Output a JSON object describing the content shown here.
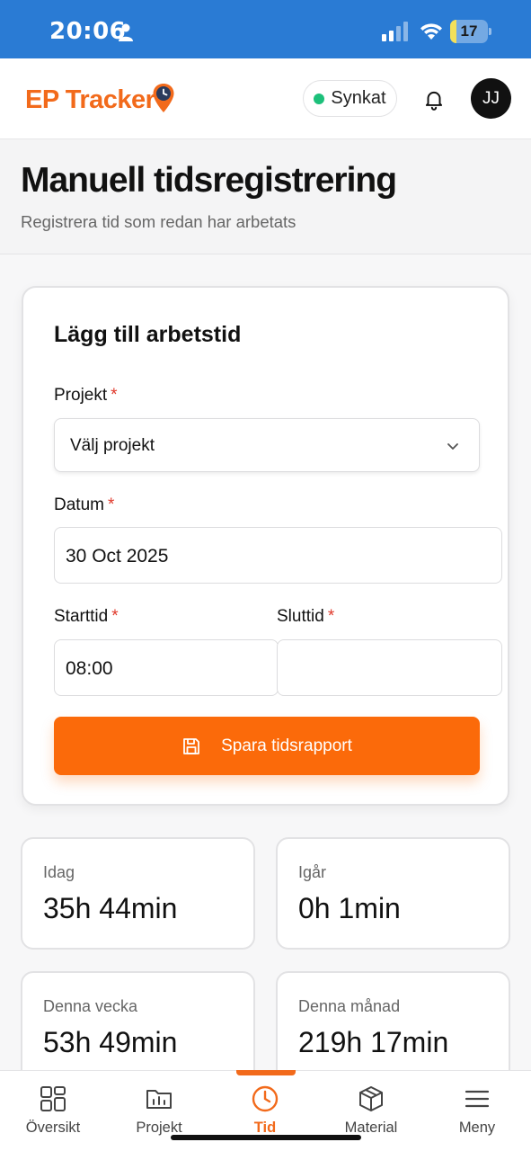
{
  "status_bar": {
    "time": "20:06",
    "battery": "17",
    "battery_level": 0.17
  },
  "header": {
    "logo": "EP Tracker",
    "sync_status": "Synkat",
    "avatar_initials": "JJ"
  },
  "page": {
    "title": "Manuell tidsregistrering",
    "subtitle": "Registrera tid som redan har arbetats"
  },
  "form": {
    "title": "Lägg till arbetstid",
    "project_label": "Projekt",
    "project_value": "Välj projekt",
    "date_label": "Datum",
    "date_value": "30 Oct 2025",
    "start_label": "Starttid",
    "start_value": "08:00",
    "end_label": "Sluttid",
    "end_value": "",
    "required_mark": "*",
    "save_label": "Spara tidsrapport"
  },
  "stats": [
    {
      "label": "Idag",
      "value": "35h 44min"
    },
    {
      "label": "Igår",
      "value": "0h 1min"
    },
    {
      "label": "Denna vecka",
      "value": "53h 49min"
    },
    {
      "label": "Denna månad",
      "value": "219h 17min"
    }
  ],
  "nav": {
    "items": [
      {
        "label": "Översikt",
        "icon": "grid-icon"
      },
      {
        "label": "Projekt",
        "icon": "folder-chart-icon"
      },
      {
        "label": "Tid",
        "icon": "clock-icon"
      },
      {
        "label": "Material",
        "icon": "box-icon"
      },
      {
        "label": "Meny",
        "icon": "menu-icon"
      }
    ],
    "active": "Tid"
  },
  "colors": {
    "accent": "#fb6a0a",
    "status_bar": "#2a7bd4",
    "sync_dot": "#1cc07a",
    "required": "#e0392b"
  }
}
